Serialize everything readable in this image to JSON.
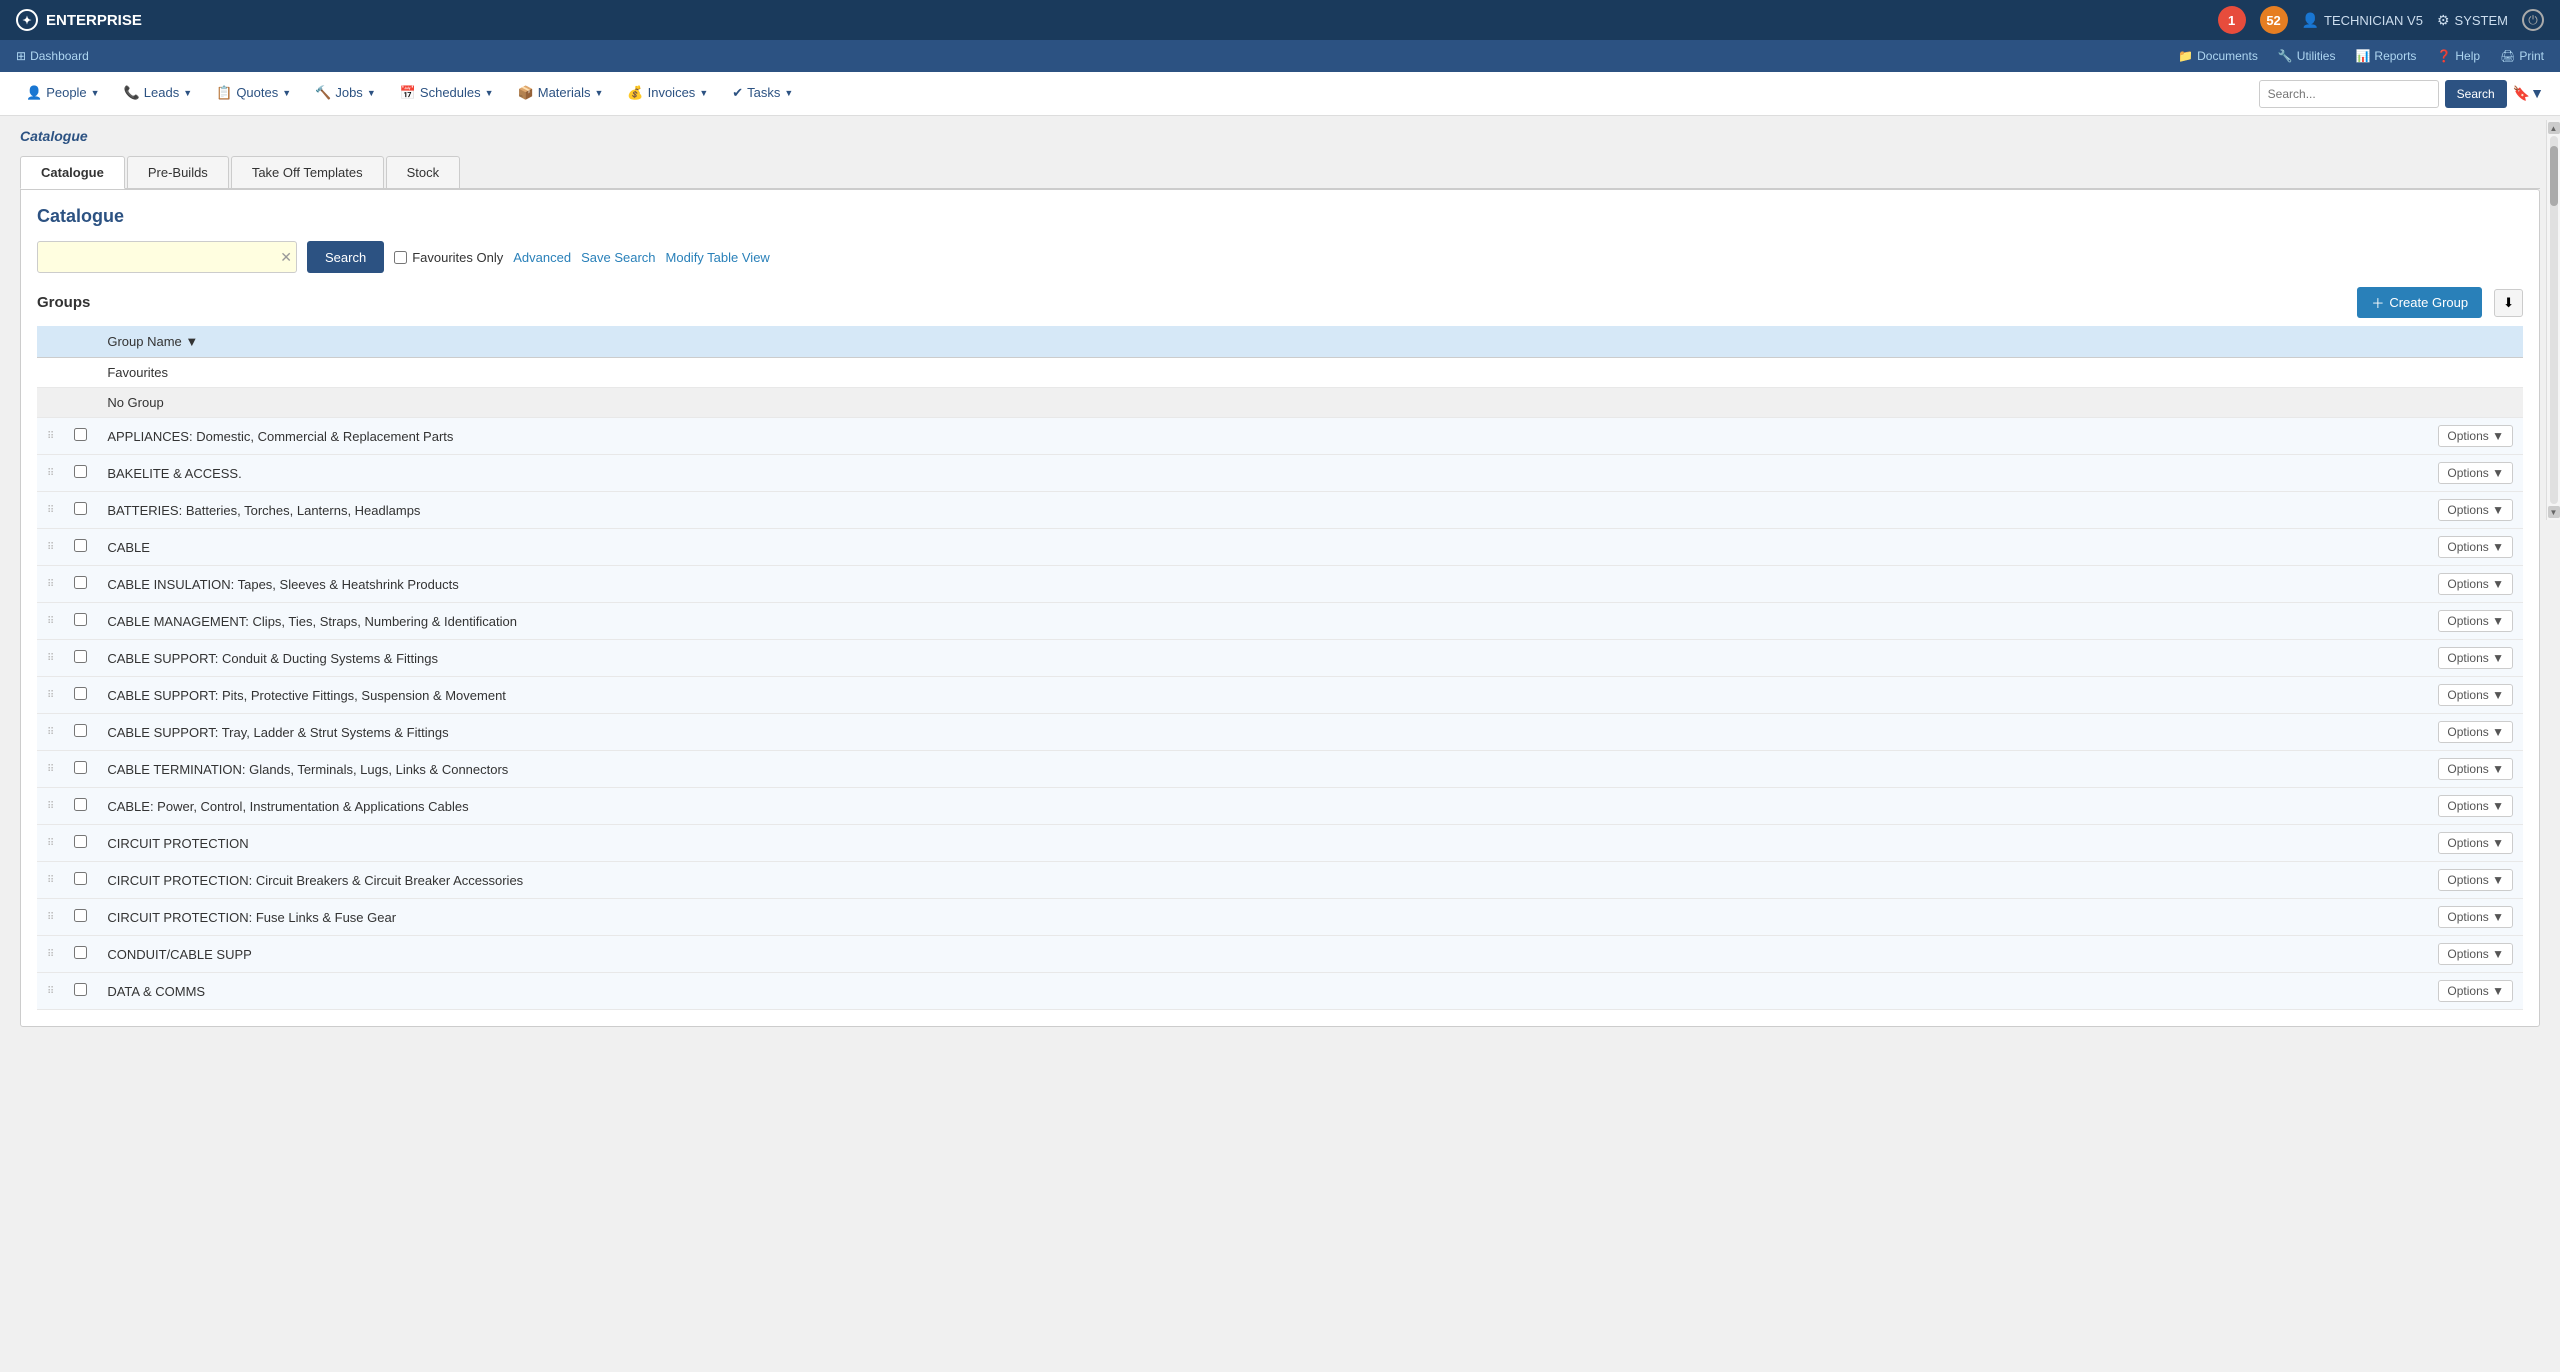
{
  "topbar": {
    "brand": "ENTERPRISE",
    "brand_icon": "✦",
    "notification_count": "1",
    "message_count": "52",
    "user_label": "TECHNICIAN V5",
    "system_label": "SYSTEM",
    "power_icon": "⏻"
  },
  "secondbar": {
    "dashboard_label": "Dashboard",
    "dashboard_icon": "⊞",
    "right_links": [
      {
        "label": "Documents",
        "icon": "📁"
      },
      {
        "label": "Utilities",
        "icon": "🔧"
      },
      {
        "label": "Reports",
        "icon": "📊"
      },
      {
        "label": "Help",
        "icon": "❓"
      },
      {
        "label": "Print",
        "icon": "🖨"
      }
    ]
  },
  "navbar": {
    "items": [
      {
        "label": "People",
        "icon": "👤",
        "key": "people"
      },
      {
        "label": "Leads",
        "icon": "📞",
        "key": "leads"
      },
      {
        "label": "Quotes",
        "icon": "📋",
        "key": "quotes"
      },
      {
        "label": "Jobs",
        "icon": "🔨",
        "key": "jobs"
      },
      {
        "label": "Schedules",
        "icon": "📅",
        "key": "schedules"
      },
      {
        "label": "Materials",
        "icon": "📦",
        "key": "materials"
      },
      {
        "label": "Invoices",
        "icon": "💰",
        "key": "invoices"
      },
      {
        "label": "Tasks",
        "icon": "✔",
        "key": "tasks"
      }
    ],
    "search_placeholder": "Search...",
    "search_button": "Search"
  },
  "page": {
    "breadcrumb": "Catalogue",
    "tabs": [
      {
        "label": "Catalogue",
        "active": true
      },
      {
        "label": "Pre-Builds",
        "active": false
      },
      {
        "label": "Take Off Templates",
        "active": false
      },
      {
        "label": "Stock",
        "active": false
      }
    ],
    "catalogue_title": "Catalogue",
    "search_placeholder": "",
    "search_button": "Search",
    "favourites_label": "Favourites Only",
    "advanced_label": "Advanced",
    "save_search_label": "Save Search",
    "modify_table_label": "Modify Table View",
    "groups_title": "Groups",
    "create_group_btn": "Create Group",
    "group_name_col": "Group Name",
    "sort_icon": "▼",
    "groups": [
      {
        "id": "favourites",
        "name": "Favourites",
        "special": true,
        "type": "favourites"
      },
      {
        "id": "no-group",
        "name": "No Group",
        "special": true,
        "type": "no-group"
      },
      {
        "id": "1",
        "name": "APPLIANCES: Domestic, Commercial & Replacement Parts",
        "hasOptions": true
      },
      {
        "id": "2",
        "name": "BAKELITE & ACCESS.",
        "hasOptions": true
      },
      {
        "id": "3",
        "name": "BATTERIES: Batteries, Torches, Lanterns, Headlamps",
        "hasOptions": true
      },
      {
        "id": "4",
        "name": "CABLE",
        "hasOptions": true
      },
      {
        "id": "5",
        "name": "CABLE INSULATION: Tapes, Sleeves & Heatshrink Products",
        "hasOptions": true
      },
      {
        "id": "6",
        "name": "CABLE MANAGEMENT: Clips, Ties, Straps, Numbering & Identification",
        "hasOptions": true
      },
      {
        "id": "7",
        "name": "CABLE SUPPORT: Conduit & Ducting Systems & Fittings",
        "hasOptions": true
      },
      {
        "id": "8",
        "name": "CABLE SUPPORT: Pits, Protective Fittings, Suspension & Movement",
        "hasOptions": true
      },
      {
        "id": "9",
        "name": "CABLE SUPPORT: Tray, Ladder & Strut Systems & Fittings",
        "hasOptions": true
      },
      {
        "id": "10",
        "name": "CABLE TERMINATION: Glands, Terminals, Lugs, Links & Connectors",
        "hasOptions": true
      },
      {
        "id": "11",
        "name": "CABLE: Power, Control, Instrumentation & Applications Cables",
        "hasOptions": true
      },
      {
        "id": "12",
        "name": "CIRCUIT PROTECTION",
        "hasOptions": true
      },
      {
        "id": "13",
        "name": "CIRCUIT PROTECTION: Circuit Breakers & Circuit Breaker Accessories",
        "hasOptions": true
      },
      {
        "id": "14",
        "name": "CIRCUIT PROTECTION: Fuse Links & Fuse Gear",
        "hasOptions": true
      },
      {
        "id": "15",
        "name": "CONDUIT/CABLE SUPP",
        "hasOptions": true
      },
      {
        "id": "16",
        "name": "DATA & COMMS",
        "hasOptions": true
      }
    ],
    "options_label": "Options ▼"
  }
}
